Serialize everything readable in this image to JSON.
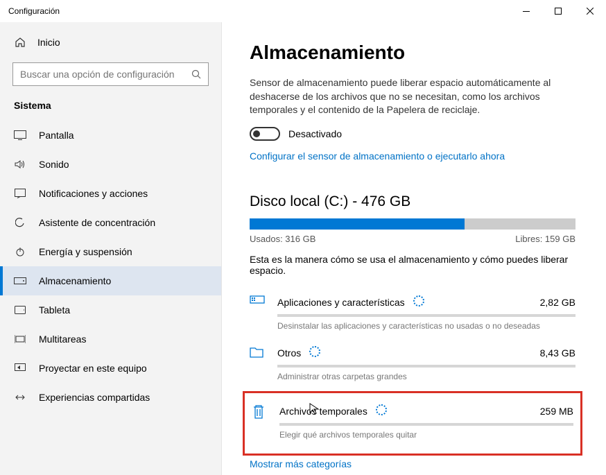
{
  "window": {
    "title": "Configuración"
  },
  "sidebar": {
    "home": "Inicio",
    "search_placeholder": "Buscar una opción de configuración",
    "section": "Sistema",
    "items": [
      {
        "label": "Pantalla"
      },
      {
        "label": "Sonido"
      },
      {
        "label": "Notificaciones y acciones"
      },
      {
        "label": "Asistente de concentración"
      },
      {
        "label": "Energía y suspensión"
      },
      {
        "label": "Almacenamiento"
      },
      {
        "label": "Tableta"
      },
      {
        "label": "Multitareas"
      },
      {
        "label": "Proyectar en este equipo"
      },
      {
        "label": "Experiencias compartidas"
      }
    ]
  },
  "main": {
    "title": "Almacenamiento",
    "sensor_desc": "Sensor de almacenamiento puede liberar espacio automáticamente al deshacerse de los archivos que no se necesitan, como los archivos temporales y el contenido de la Papelera de reciclaje.",
    "toggle_state": "Desactivado",
    "config_link": "Configurar el sensor de almacenamiento o ejecutarlo ahora",
    "disk": {
      "title": "Disco local (C:) - 476 GB",
      "used_label": "Usados: 316 GB",
      "free_label": "Libres: 159 GB",
      "fill_percent": 66,
      "how_text": "Esta es la manera cómo se usa el almacenamiento y cómo puedes liberar espacio."
    },
    "categories": [
      {
        "name": "Aplicaciones y características",
        "size": "2,82 GB",
        "sub": "Desinstalar las aplicaciones y características no usadas o no deseadas"
      },
      {
        "name": "Otros",
        "size": "8,43 GB",
        "sub": "Administrar otras carpetas grandes"
      },
      {
        "name": "Archivos temporales",
        "size": "259 MB",
        "sub": "Elegir qué archivos temporales quitar"
      }
    ],
    "more_link": "Mostrar más categorías"
  }
}
